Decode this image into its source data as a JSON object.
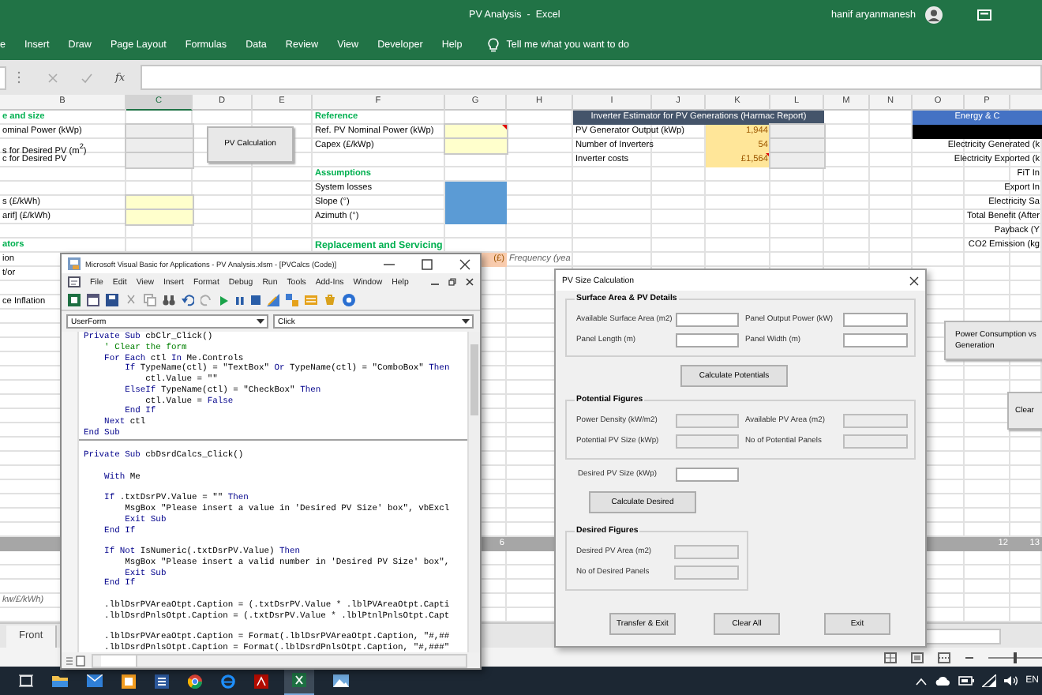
{
  "window": {
    "title": "PV Analysis  -  Excel",
    "user": "hanif aryanmanesh"
  },
  "ribbon_tabs": [
    "e",
    "Insert",
    "Draw",
    "Page Layout",
    "Formulas",
    "Data",
    "Review",
    "View",
    "Developer",
    "Help"
  ],
  "tell_me": "Tell me what you want to do",
  "formula_bar": {
    "function_label": "fx"
  },
  "sheet": {
    "columns": [
      {
        "letter": "B",
        "selected": false
      },
      {
        "letter": "C",
        "selected": true
      },
      {
        "letter": "D",
        "selected": false
      },
      {
        "letter": "E",
        "selected": false
      },
      {
        "letter": "F",
        "selected": false
      },
      {
        "letter": "G",
        "selected": false
      },
      {
        "letter": "H",
        "selected": false
      },
      {
        "letter": "I",
        "selected": false
      },
      {
        "letter": "J",
        "selected": false
      },
      {
        "letter": "K",
        "selected": false
      },
      {
        "letter": "L",
        "selected": false
      },
      {
        "letter": "M",
        "selected": false
      },
      {
        "letter": "N",
        "selected": false
      },
      {
        "letter": "O",
        "selected": false
      },
      {
        "letter": "P",
        "selected": false
      }
    ],
    "size_table": {
      "heading": "e and size",
      "rows": [
        "ominal Power (kWp)",
        "s for Desired PV (m$^{2}$)",
        "c for Desired PV"
      ]
    },
    "tariffs": [
      "s (£/kWh)",
      "arif] (£/kWh)"
    ],
    "factors": {
      "heading": "ators",
      "rows": [
        "ion",
        "t/or"
      ]
    },
    "inflation": "ce Inflation",
    "reference": {
      "heading": "Reference",
      "rows": [
        {
          "label": "Ref. PV Nominal Power (kWp)",
          "comment": true
        },
        {
          "label": "Capex (£/kWp)",
          "comment": false
        }
      ]
    },
    "assumptions": {
      "heading": "Assumptions",
      "rows": [
        "System losses",
        "Slope (°)",
        "Azimuth (°)"
      ]
    },
    "replacement": {
      "heading": "Replacement and Servicing",
      "unit": "(£)",
      "frequency": "Frequency (yea"
    },
    "inverter": {
      "title": "Inverter Estimator for PV Generations (Harmac Report)",
      "rows": [
        {
          "label": "PV Generator Output (kWp)",
          "value": "1,944",
          "comment": false
        },
        {
          "label": "Number of Inverters",
          "value": "54",
          "comment": false
        },
        {
          "label": "Inverter costs",
          "value": "£1,564",
          "comment": true
        }
      ]
    },
    "energy": {
      "title": "Energy & C",
      "rows": [
        "Electricity Generated (k",
        "Electricity Exported (k",
        "FiT In",
        "Export In",
        "Electricity Sa",
        "Total Benefit (After",
        "Payback (Y",
        "CO2 Emission (kg"
      ]
    },
    "band_values": [
      "6",
      "12",
      "13"
    ],
    "note": "kw/£/kWh)",
    "buttons": [
      {
        "kind": "pv",
        "label": "PV Calculation"
      },
      {
        "kind": "chart",
        "label": "Power Consumption vs Generation"
      },
      {
        "kind": "clear",
        "label": "Clear"
      }
    ]
  },
  "sheet_tabs": [
    "Front"
  ],
  "zoom_slider": {
    "level": 0.5
  },
  "vba_window": {
    "title": "Microsoft Visual Basic for Applications - PV Analysis.xlsm - [PVCalcs (Code)]",
    "menu": [
      "File",
      "Edit",
      "View",
      "Insert",
      "Format",
      "Debug",
      "Run",
      "Tools",
      "Add-Ins",
      "Window",
      "Help"
    ],
    "object_box": "UserForm",
    "procedure_box": "Click",
    "code": [
      {
        "kind": "code",
        "tokens": [
          {
            "t": "Private Sub",
            "kind": "keyword"
          },
          {
            "t": " cbClr_Click()"
          }
        ]
      },
      {
        "kind": "code",
        "tokens": [
          {
            "t": "    ' Clear the form",
            "kind": "comment"
          }
        ]
      },
      {
        "kind": "code",
        "tokens": [
          {
            "t": "    For Each",
            "kind": "keyword"
          },
          {
            "t": " ctl "
          },
          {
            "t": "In",
            "kind": "keyword"
          },
          {
            "t": " Me.Controls"
          }
        ]
      },
      {
        "kind": "code",
        "tokens": [
          {
            "t": "        If",
            "kind": "keyword"
          },
          {
            "t": " TypeName(ctl) = \"TextBox\" "
          },
          {
            "t": "Or",
            "kind": "keyword"
          },
          {
            "t": " TypeName(ctl) = \"ComboBox\" "
          },
          {
            "t": "Then",
            "kind": "keyword"
          }
        ]
      },
      {
        "kind": "code",
        "tokens": [
          {
            "t": "            ctl.Value = \"\""
          }
        ]
      },
      {
        "kind": "code",
        "tokens": [
          {
            "t": "        ElseIf",
            "kind": "keyword"
          },
          {
            "t": " TypeName(ctl) = \"CheckBox\" "
          },
          {
            "t": "Then",
            "kind": "keyword"
          }
        ]
      },
      {
        "kind": "code",
        "tokens": [
          {
            "t": "            ctl.Value = "
          },
          {
            "t": "False",
            "kind": "keyword"
          }
        ]
      },
      {
        "kind": "code",
        "tokens": [
          {
            "t": "        End If",
            "kind": "keyword"
          }
        ]
      },
      {
        "kind": "code",
        "tokens": [
          {
            "t": "    Next",
            "kind": "keyword"
          },
          {
            "t": " ctl"
          }
        ]
      },
      {
        "kind": "code",
        "tokens": [
          {
            "t": "End Sub",
            "kind": "keyword"
          }
        ]
      },
      {
        "kind": "separator"
      },
      {
        "kind": "blank"
      },
      {
        "kind": "code",
        "tokens": [
          {
            "t": "Private Sub",
            "kind": "keyword"
          },
          {
            "t": " cbDsrdCalcs_Click()"
          }
        ]
      },
      {
        "kind": "blank"
      },
      {
        "kind": "code",
        "tokens": [
          {
            "t": "    With",
            "kind": "keyword"
          },
          {
            "t": " Me"
          }
        ]
      },
      {
        "kind": "blank"
      },
      {
        "kind": "code",
        "tokens": [
          {
            "t": "    If",
            "kind": "keyword"
          },
          {
            "t": " .txtDsrPV.Value = \"\" "
          },
          {
            "t": "Then",
            "kind": "keyword"
          }
        ]
      },
      {
        "kind": "code",
        "tokens": [
          {
            "t": "        MsgBox \"Please insert a value in 'Desired PV Size' box\", vbExcl"
          }
        ]
      },
      {
        "kind": "code",
        "tokens": [
          {
            "t": "        Exit Sub",
            "kind": "keyword"
          }
        ]
      },
      {
        "kind": "code",
        "tokens": [
          {
            "t": "    End If",
            "kind": "keyword"
          }
        ]
      },
      {
        "kind": "blank"
      },
      {
        "kind": "code",
        "tokens": [
          {
            "t": "    If Not",
            "kind": "keyword"
          },
          {
            "t": " IsNumeric(.txtDsrPV.Value) "
          },
          {
            "t": "Then",
            "kind": "keyword"
          }
        ]
      },
      {
        "kind": "code",
        "tokens": [
          {
            "t": "        MsgBox \"Please insert a valid number in 'Desired PV Size' box\","
          }
        ]
      },
      {
        "kind": "code",
        "tokens": [
          {
            "t": "        Exit Sub",
            "kind": "keyword"
          }
        ]
      },
      {
        "kind": "code",
        "tokens": [
          {
            "t": "    End If",
            "kind": "keyword"
          }
        ]
      },
      {
        "kind": "blank"
      },
      {
        "kind": "code",
        "tokens": [
          {
            "t": "    .lblDsrPVAreaOtpt.Caption = (.txtDsrPV.Value * .lblPVAreaOtpt.Capti"
          }
        ]
      },
      {
        "kind": "code",
        "tokens": [
          {
            "t": "    .lblDsrdPnlsOtpt.Caption = (.txtDsrPV.Value * .lblPtnlPnlsOtpt.Capt"
          }
        ]
      },
      {
        "kind": "blank"
      },
      {
        "kind": "code",
        "tokens": [
          {
            "t": "    .lblDsrPVAreaOtpt.Caption = Format(.lblDsrPVAreaOtpt.Caption, \"#,##"
          }
        ]
      },
      {
        "kind": "code",
        "tokens": [
          {
            "t": "    .lblDsrdPnlsOtpt.Caption = Format(.lblDsrdPnlsOtpt.Caption, \"#,###\""
          }
        ]
      }
    ]
  },
  "userform": {
    "title": "PV Size Calculation",
    "surface_frame": {
      "legend": "Surface Area & PV Details",
      "fields": [
        {
          "label": "Available Surface Area (m2)",
          "kind": "input"
        },
        {
          "label": "Panel Output Power (kW)",
          "kind": "input"
        },
        {
          "label": "Panel Length (m)",
          "kind": "input"
        },
        {
          "label": "Panel Width (m)",
          "kind": "input"
        }
      ]
    },
    "calculate_potentials": "Calculate Potentials",
    "potential_frame": {
      "legend": "Potential Figures",
      "fields": [
        {
          "label": "Power Density (kW/m2)",
          "kind": "output"
        },
        {
          "label": "Available PV Area (m2)",
          "kind": "output"
        },
        {
          "label": "Potential PV Size (kWp)",
          "kind": "output"
        },
        {
          "label": "No of Potential Panels",
          "kind": "output"
        }
      ]
    },
    "desired_size": {
      "label": "Desired PV Size (kWp)",
      "kind": "input"
    },
    "calculate_desired": "Calculate Desired",
    "desired_frame": {
      "legend": "Desired Figures",
      "fields": [
        {
          "label": "Desired PV Area (m2)",
          "kind": "output"
        },
        {
          "label": "No of Desired Panels",
          "kind": "output"
        }
      ]
    },
    "buttons": [
      "Transfer & Exit",
      "Clear All",
      "Exit"
    ]
  },
  "taskbar": {
    "language": "EN"
  }
}
